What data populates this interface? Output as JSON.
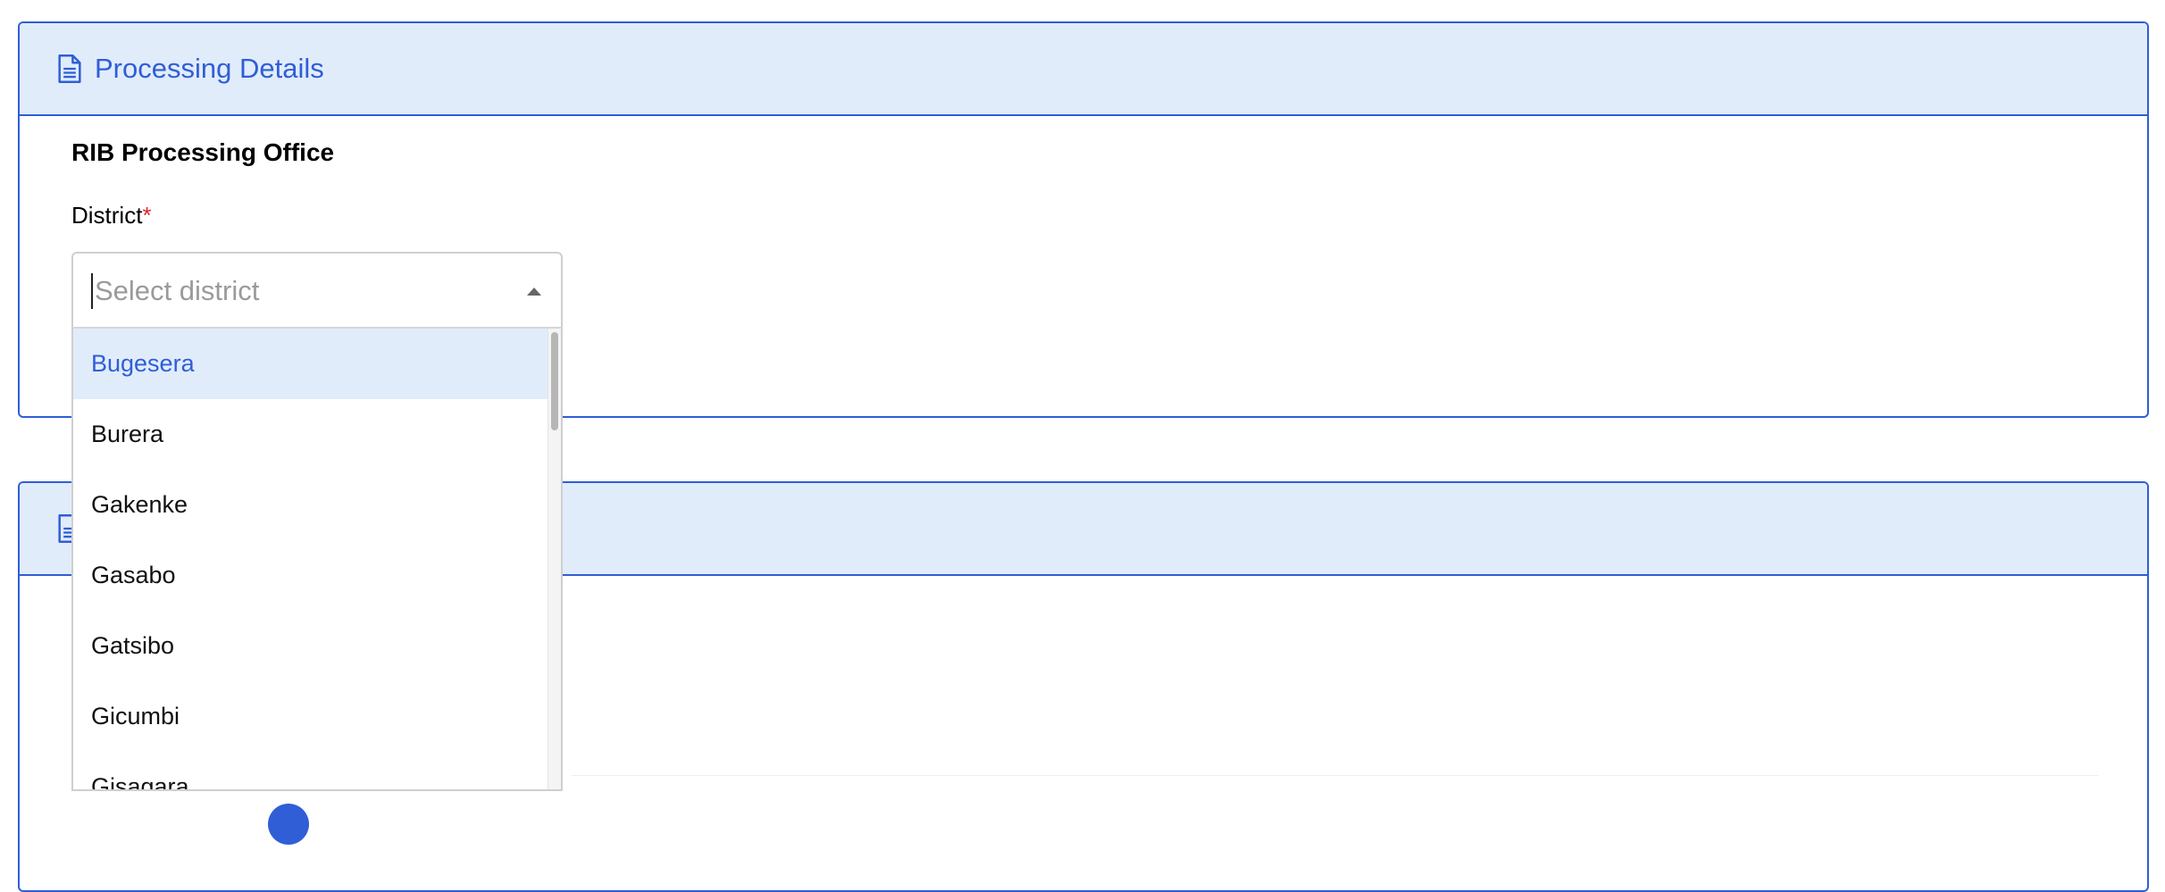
{
  "processing_panel": {
    "title": "Processing Details",
    "icon": "document-icon",
    "section_title": "RIB Processing Office",
    "district_field": {
      "label": "District",
      "required_mark": "*",
      "placeholder": "Select district",
      "options": [
        "Bugesera",
        "Burera",
        "Gakenke",
        "Gasabo",
        "Gatsibo",
        "Gicumbi",
        "Gisagara"
      ],
      "highlighted_option": "Bugesera"
    }
  },
  "second_panel": {
    "icon": "document-icon"
  },
  "colors": {
    "accent": "#2f5ed6",
    "header_bg": "#e1ecfb",
    "required": "#e02424"
  }
}
